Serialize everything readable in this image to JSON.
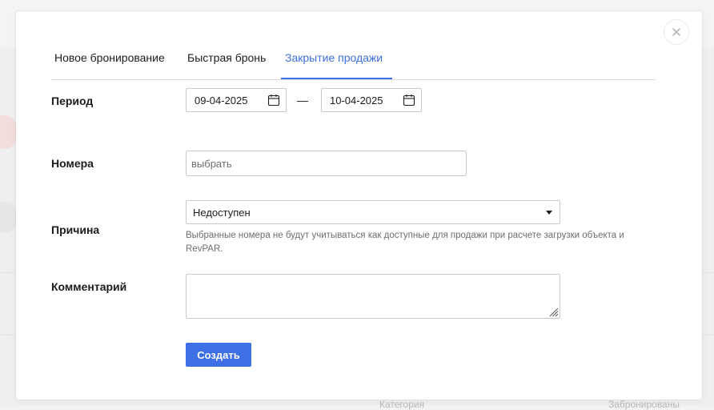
{
  "background": {
    "column_1": "Категория",
    "column_2": "Забронированы"
  },
  "tabs": [
    {
      "label": "Новое бронирование",
      "active": false
    },
    {
      "label": "Быстрая бронь",
      "active": false
    },
    {
      "label": "Закрытие продажи",
      "active": true
    }
  ],
  "form": {
    "period": {
      "label": "Период",
      "date_from": "09-04-2025",
      "date_to": "10-04-2025",
      "separator": "—"
    },
    "rooms": {
      "label": "Номера",
      "placeholder": "выбрать"
    },
    "reason": {
      "label": "Причина",
      "selected": "Недоступен",
      "hint": "Выбранные номера не будут учитываться как доступные для продажи при расчете загрузки объекта и RevPAR."
    },
    "comment": {
      "label": "Комментарий",
      "value": ""
    },
    "submit_label": "Создать"
  },
  "icons": {
    "close": "close-icon",
    "calendar": "calendar-icon",
    "dropdown": "chevron-down-icon",
    "resize": "resize-handle-icon"
  },
  "colors": {
    "accent": "#3e6fe4",
    "text": "#1c1c1e",
    "muted": "#6e6e73",
    "border": "#c9c9cc"
  }
}
